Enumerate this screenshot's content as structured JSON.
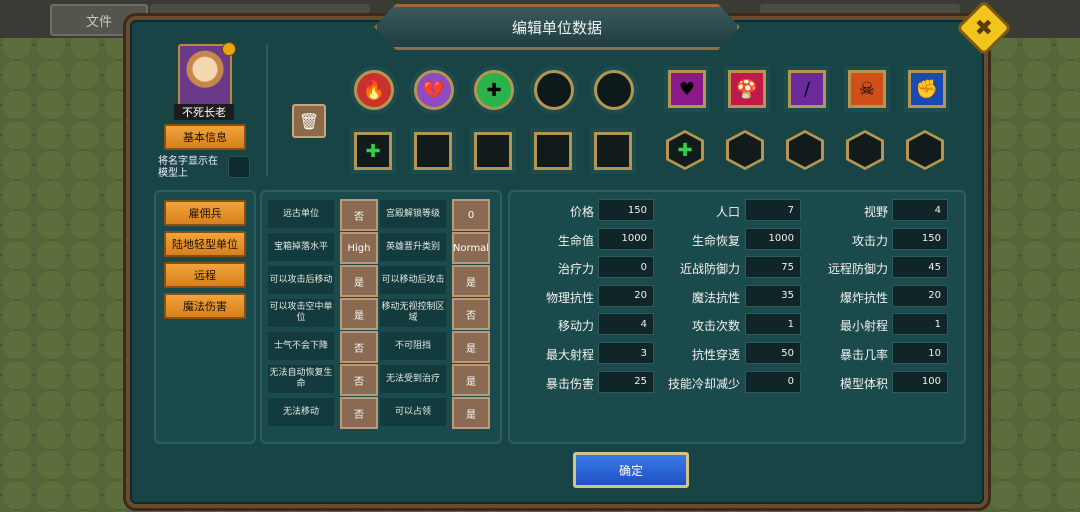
{
  "topbar": {
    "file_tab": "文件"
  },
  "dialog": {
    "title": "编辑单位数据",
    "confirm_label": "确定"
  },
  "unit": {
    "name": "不死长老",
    "basic_info_label": "基本信息",
    "show_name_label": "将名字显示在模型上"
  },
  "categories": [
    "雇佣兵",
    "陆地轻型单位",
    "远程",
    "魔法伤害"
  ],
  "slots": {
    "row1_circles": [
      {
        "icon": "flame-burst-icon",
        "glyph": "🔥",
        "color": "#c8322a"
      },
      {
        "icon": "broken-heart-icon",
        "glyph": "💔",
        "color": "#8e4bc4"
      },
      {
        "icon": "heal-plus-icon",
        "glyph": "✚",
        "color": "#29b34a"
      },
      {
        "icon": "empty-slot-icon",
        "glyph": "",
        "color": "#111"
      },
      {
        "icon": "empty-slot-icon",
        "glyph": "",
        "color": "#111"
      }
    ],
    "row1_squares": [
      {
        "icon": "heart-hand-icon",
        "glyph": "♥",
        "color": "#8a1a8a"
      },
      {
        "icon": "mushroom-icon",
        "glyph": "🍄",
        "color": "#c01a4a"
      },
      {
        "icon": "sword-slash-icon",
        "glyph": "/",
        "color": "#6a2a9a"
      },
      {
        "icon": "skull-fire-icon",
        "glyph": "☠",
        "color": "#d0501a"
      },
      {
        "icon": "fist-shield-icon",
        "glyph": "✊",
        "color": "#1a4ab0"
      }
    ],
    "row2_squares": [
      {
        "icon": "heal-plus-icon",
        "glyph": "✚"
      },
      {
        "icon": "empty-slot-icon",
        "glyph": ""
      },
      {
        "icon": "empty-slot-icon",
        "glyph": ""
      },
      {
        "icon": "empty-slot-icon",
        "glyph": ""
      },
      {
        "icon": "empty-slot-icon",
        "glyph": ""
      }
    ],
    "row2_hexes": [
      {
        "icon": "heal-plus-icon",
        "glyph": "✚"
      },
      {
        "icon": "empty-slot-icon",
        "glyph": ""
      },
      {
        "icon": "empty-slot-icon",
        "glyph": ""
      },
      {
        "icon": "empty-slot-icon",
        "glyph": ""
      },
      {
        "icon": "empty-slot-icon",
        "glyph": ""
      }
    ]
  },
  "flags": [
    {
      "label": "远古单位",
      "value": "否"
    },
    {
      "label": "宫殿解锁等级",
      "value": "0"
    },
    {
      "label": "宝箱掉落水平",
      "value": "High"
    },
    {
      "label": "英雄晋升类别",
      "value": "Normal"
    },
    {
      "label": "可以攻击后移动",
      "value": "是"
    },
    {
      "label": "可以移动后攻击",
      "value": "是"
    },
    {
      "label": "可以攻击空中单位",
      "value": "是"
    },
    {
      "label": "移动无视控制区域",
      "value": "否"
    },
    {
      "label": "士气不会下降",
      "value": "否"
    },
    {
      "label": "不可阻挡",
      "value": "是"
    },
    {
      "label": "无法自动恢复生命",
      "value": "否"
    },
    {
      "label": "无法受到治疗",
      "value": "是"
    },
    {
      "label": "无法移动",
      "value": "否"
    },
    {
      "label": "可以占领",
      "value": "是"
    }
  ],
  "stats": [
    {
      "label": "价格",
      "value": "150"
    },
    {
      "label": "人口",
      "value": "7"
    },
    {
      "label": "视野",
      "value": "4"
    },
    {
      "label": "生命值",
      "value": "1000"
    },
    {
      "label": "生命恢复",
      "value": "1000"
    },
    {
      "label": "攻击力",
      "value": "150"
    },
    {
      "label": "治疗力",
      "value": "0"
    },
    {
      "label": "近战防御力",
      "value": "75"
    },
    {
      "label": "远程防御力",
      "value": "45"
    },
    {
      "label": "物理抗性",
      "value": "20"
    },
    {
      "label": "魔法抗性",
      "value": "35"
    },
    {
      "label": "爆炸抗性",
      "value": "20"
    },
    {
      "label": "移动力",
      "value": "4"
    },
    {
      "label": "攻击次数",
      "value": "1"
    },
    {
      "label": "最小射程",
      "value": "1"
    },
    {
      "label": "最大射程",
      "value": "3"
    },
    {
      "label": "抗性穿透",
      "value": "50"
    },
    {
      "label": "暴击几率",
      "value": "10"
    },
    {
      "label": "暴击伤害",
      "value": "25"
    },
    {
      "label": "技能冷却减少",
      "value": "0"
    },
    {
      "label": "模型体积",
      "value": "100"
    }
  ]
}
